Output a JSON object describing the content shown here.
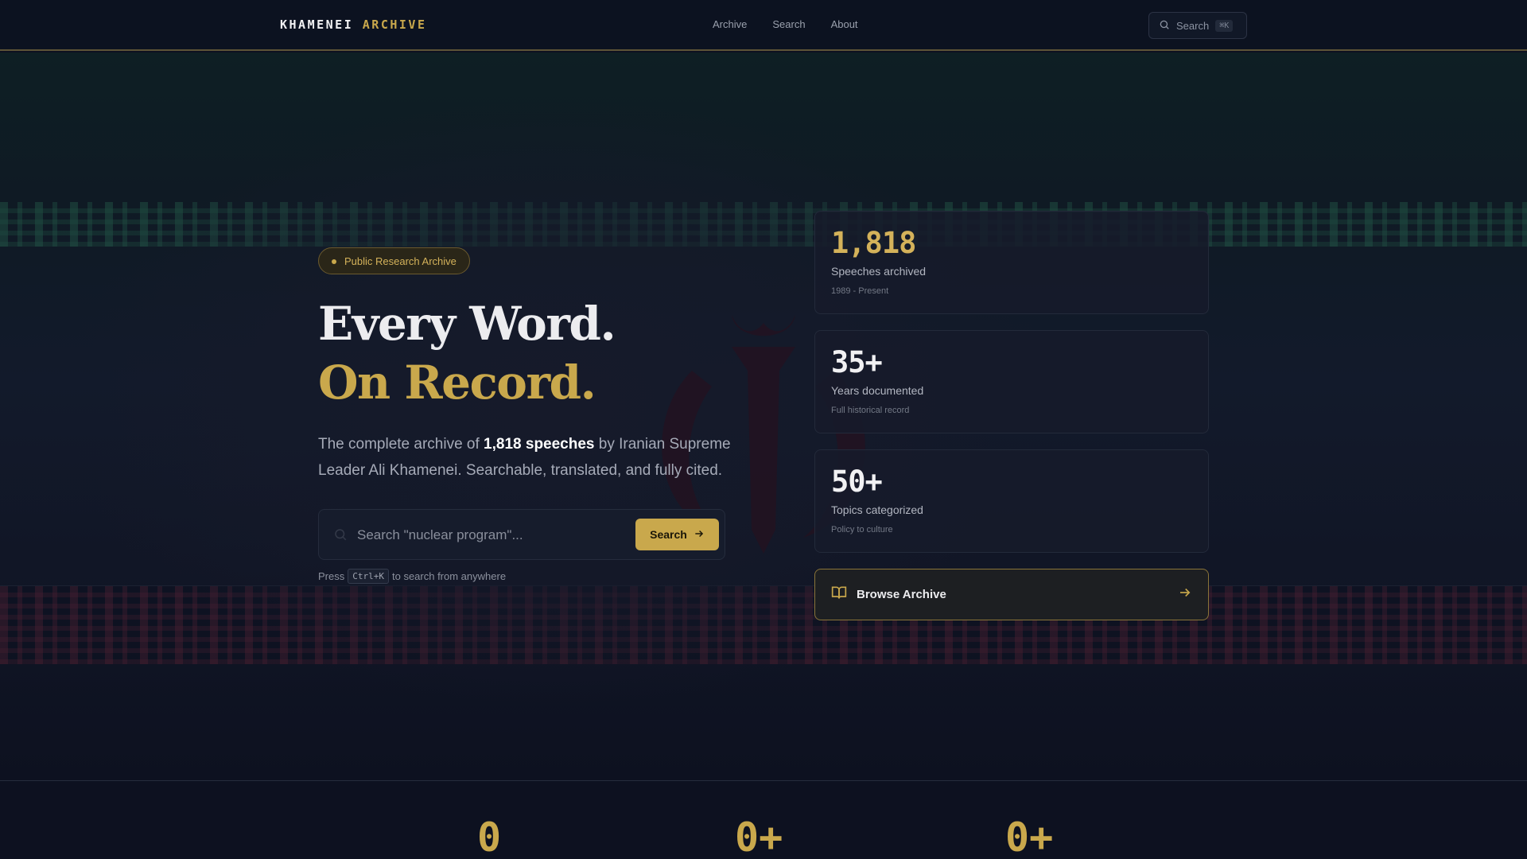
{
  "header": {
    "logo_primary": "KHAMENEI",
    "logo_accent": "ARCHIVE",
    "nav": [
      "Archive",
      "Search",
      "About"
    ],
    "search_label": "Search",
    "search_shortcut": "⌘K"
  },
  "hero": {
    "badge": "Public Research Archive",
    "heading_line1": "Every Word.",
    "heading_line2": "On Record.",
    "lead_prefix": "The complete archive of ",
    "lead_bold": "1,818 speeches",
    "lead_suffix": " by Iranian Supreme Leader Ali Khamenei. Searchable, translated, and fully cited.",
    "search_placeholder": "Search \"nuclear program\"...",
    "search_button": "Search",
    "hint_prefix": "Press",
    "hint_key": "Ctrl+K",
    "hint_suffix": "to search from anywhere"
  },
  "stats": [
    {
      "value": "1,818",
      "label": "Speeches archived",
      "sub": "1989 - Present"
    },
    {
      "value": "35+",
      "label": "Years documented",
      "sub": "Full historical record"
    },
    {
      "value": "50+",
      "label": "Topics categorized",
      "sub": "Policy to culture"
    }
  ],
  "browse_label": "Browse Archive",
  "bottom_stats": [
    "0",
    "0+",
    "0+"
  ],
  "colors": {
    "accent": "#c9a84c",
    "background": "#0d1120",
    "card": "#161b2a"
  }
}
